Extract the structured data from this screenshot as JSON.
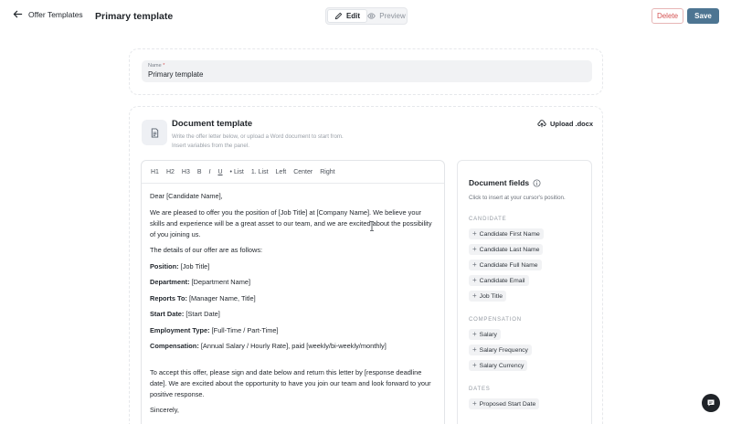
{
  "header": {
    "back_label": "Offer Templates",
    "title": "Primary template",
    "modes": {
      "edit": "Edit",
      "preview": "Preview",
      "active": "edit"
    },
    "delete_label": "Delete",
    "save_label": "Save"
  },
  "name_field": {
    "label": "Name",
    "required_mark": "*",
    "value": "Primary template"
  },
  "document_template": {
    "title": "Document template",
    "description_line1": "Write the offer letter below, or upload a Word document to start from.",
    "description_line2": "Insert variables from the panel.",
    "upload_label": "Upload .docx"
  },
  "toolbar": {
    "items": [
      "H1",
      "H2",
      "H3",
      "B",
      "I",
      "U",
      "• List",
      "1. List",
      "Left",
      "Center",
      "Right"
    ]
  },
  "editor": {
    "greeting": "Dear [Candidate Name],",
    "intro": "We are pleased to offer you the position of [Job Title] at [Company Name]. We believe your skills and experience will be a great asset to our team, and we are excited about the possibility of you joining us.",
    "details_intro": "The details of our offer are as follows:",
    "details": [
      {
        "label": "Position:",
        "value": " [Job Title]"
      },
      {
        "label": "Department:",
        "value": " [Department Name]"
      },
      {
        "label": "Reports To:",
        "value": " [Manager Name, Title]"
      },
      {
        "label": "Start Date:",
        "value": " [Start Date]"
      },
      {
        "label": "Employment Type:",
        "value": " [Full-Time / Part-Time]"
      },
      {
        "label": "Compensation:",
        "value": " [Annual Salary / Hourly Rate], paid [weekly/bi-weekly/monthly]"
      }
    ],
    "closing": "To accept this offer, please sign and date below and return this letter by [response deadline date]. We are excited about the opportunity to have you join our team and look forward to your positive response.",
    "signoff": "Sincerely,"
  },
  "fields_panel": {
    "title": "Document fields",
    "hint": "Click to insert at your cursor's position.",
    "sections": [
      {
        "label": "CANDIDATE",
        "items": [
          "Candidate First Name",
          "Candidate Last Name",
          "Candidate Full Name",
          "Candidate Email",
          "Job Title"
        ]
      },
      {
        "label": "COMPENSATION",
        "items": [
          "Salary",
          "Salary Frequency",
          "Salary Currency"
        ]
      },
      {
        "label": "DATES",
        "items": [
          "Proposed Start Date"
        ]
      }
    ]
  },
  "colors": {
    "save_button": "#4d7592",
    "delete_text": "#d45252",
    "chat_bubble": "#1f2328"
  }
}
